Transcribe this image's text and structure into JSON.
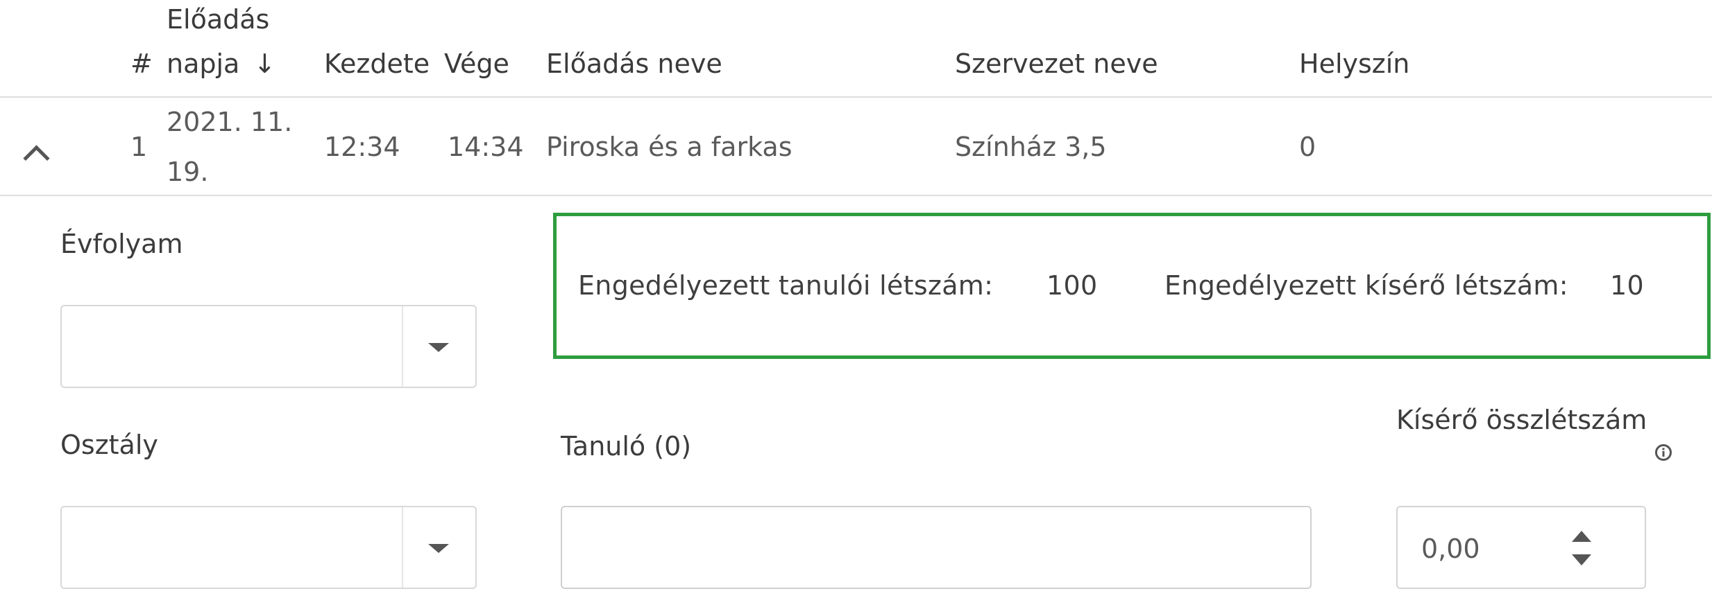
{
  "table": {
    "headers": {
      "number": "#",
      "date_line1": "Előadás",
      "date_line2": "napja",
      "sort_arrow": "↓",
      "start": "Kezdete",
      "end": "Vége",
      "title": "Előadás neve",
      "org": "Szervezet neve",
      "venue": "Helyszín"
    },
    "rows": [
      {
        "number": "1",
        "date_line1": "2021. 11.",
        "date_line2": "19.",
        "start": "12:34",
        "end": "14:34",
        "title": "Piroska és a farkas",
        "org": "Színház 3,5",
        "venue": "0"
      }
    ]
  },
  "detail": {
    "grade_label": "Évfolyam",
    "grade_value": "",
    "class_label": "Osztály",
    "class_value": "",
    "info": {
      "students_label": "Engedélyezett tanulói létszám:",
      "students_value": "100",
      "companions_label": "Engedélyezett kísérő létszám:",
      "companions_value": "10"
    },
    "student_label": "Tanuló (0)",
    "student_value": "",
    "companion_total_label": "Kísérő összlétszám",
    "companion_total_value": "0,00"
  },
  "colors": {
    "info_border": "#2e9d3f"
  },
  "icons": {
    "collapse": "chevron-up-icon",
    "dropdown": "caret-down-icon",
    "info": "info-icon",
    "stepper": "stepper-icon"
  }
}
